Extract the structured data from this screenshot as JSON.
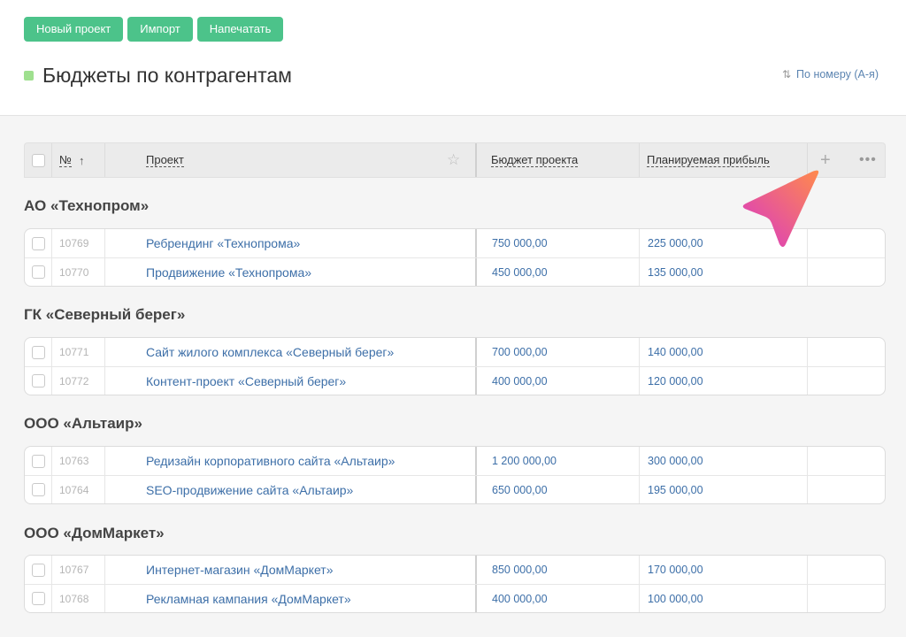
{
  "toolbar": {
    "new_project": "Новый проект",
    "import": "Импорт",
    "print": "Напечатать"
  },
  "page": {
    "title": "Бюджеты по контрагентам",
    "sort_label": "По номеру (А-я)",
    "sort_icon": "sort-arrows-icon",
    "title_marker_color": "#9fe08f",
    "accent_color": "#4cc38a"
  },
  "table": {
    "columns": {
      "number": "№",
      "number_sort": "↑",
      "project": "Проект",
      "budget": "Бюджет проекта",
      "profit": "Планируемая прибыль"
    },
    "groups": [
      {
        "name": "АО «Технопром»",
        "rows": [
          {
            "id": "10769",
            "project": "Ребрендинг «Технопрома»",
            "budget": "750 000,00",
            "profit": "225 000,00"
          },
          {
            "id": "10770",
            "project": "Продвижение «Технопрома»",
            "budget": "450 000,00",
            "profit": "135 000,00"
          }
        ]
      },
      {
        "name": "ГК «Северный берег»",
        "rows": [
          {
            "id": "10771",
            "project": "Сайт жилого комплекса «Северный берег»",
            "budget": "700 000,00",
            "profit": "140 000,00"
          },
          {
            "id": "10772",
            "project": "Контент-проект «Северный берег»",
            "budget": "400 000,00",
            "profit": "120 000,00"
          }
        ]
      },
      {
        "name": "ООО «Альтаир»",
        "rows": [
          {
            "id": "10763",
            "project": "Редизайн корпоративного сайта «Альтаир»",
            "budget": "1 200 000,00",
            "profit": "300 000,00"
          },
          {
            "id": "10764",
            "project": "SEO-продвижение сайта «Альтаир»",
            "budget": "650 000,00",
            "profit": "195 000,00"
          }
        ]
      },
      {
        "name": "ООО «ДомМаркет»",
        "rows": [
          {
            "id": "10767",
            "project": "Интернет-магазин «ДомМаркет»",
            "budget": "850 000,00",
            "profit": "170 000,00"
          },
          {
            "id": "10768",
            "project": "Рекламная кампания «ДомМаркет»",
            "budget": "400 000,00",
            "profit": "100 000,00"
          }
        ]
      }
    ]
  }
}
